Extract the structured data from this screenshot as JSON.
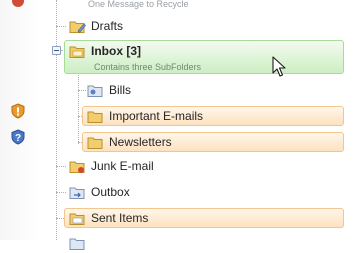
{
  "status": {
    "recycle_text": "One Message to Recycle"
  },
  "folders": {
    "drafts": {
      "label": "Drafts",
      "icon": "drafts-folder-icon"
    },
    "inbox": {
      "label": "Inbox",
      "count": "[3]",
      "subtitle": "Contains three SubFolders",
      "icon": "inbox-folder-icon"
    },
    "bills": {
      "label": "Bills",
      "icon": "folder-icon"
    },
    "important": {
      "label": "Important E-mails",
      "icon": "folder-icon"
    },
    "newsletters": {
      "label": "Newsletters",
      "icon": "folder-icon"
    },
    "junk": {
      "label": "Junk E-mail",
      "icon": "junk-folder-icon"
    },
    "outbox": {
      "label": "Outbox",
      "icon": "outbox-folder-icon"
    },
    "sent": {
      "label": "Sent Items",
      "icon": "sent-folder-icon"
    }
  },
  "colors": {
    "highlight_orange": "#fde2c0",
    "highlight_green": "#cdeec4",
    "tree_lines": "#a6b2c2"
  }
}
